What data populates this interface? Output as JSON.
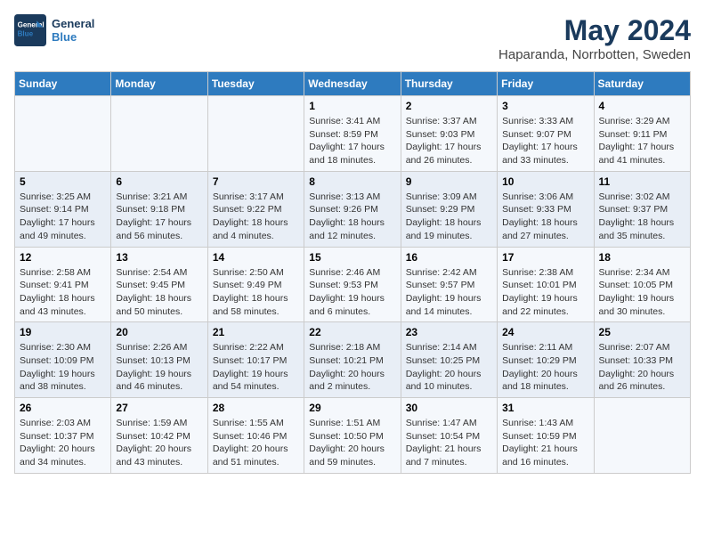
{
  "header": {
    "logo_line1": "General",
    "logo_line2": "Blue",
    "main_title": "May 2024",
    "subtitle": "Haparanda, Norrbotten, Sweden"
  },
  "days_of_week": [
    "Sunday",
    "Monday",
    "Tuesday",
    "Wednesday",
    "Thursday",
    "Friday",
    "Saturday"
  ],
  "weeks": [
    [
      {
        "num": "",
        "detail": ""
      },
      {
        "num": "",
        "detail": ""
      },
      {
        "num": "",
        "detail": ""
      },
      {
        "num": "1",
        "detail": "Sunrise: 3:41 AM\nSunset: 8:59 PM\nDaylight: 17 hours\nand 18 minutes."
      },
      {
        "num": "2",
        "detail": "Sunrise: 3:37 AM\nSunset: 9:03 PM\nDaylight: 17 hours\nand 26 minutes."
      },
      {
        "num": "3",
        "detail": "Sunrise: 3:33 AM\nSunset: 9:07 PM\nDaylight: 17 hours\nand 33 minutes."
      },
      {
        "num": "4",
        "detail": "Sunrise: 3:29 AM\nSunset: 9:11 PM\nDaylight: 17 hours\nand 41 minutes."
      }
    ],
    [
      {
        "num": "5",
        "detail": "Sunrise: 3:25 AM\nSunset: 9:14 PM\nDaylight: 17 hours\nand 49 minutes."
      },
      {
        "num": "6",
        "detail": "Sunrise: 3:21 AM\nSunset: 9:18 PM\nDaylight: 17 hours\nand 56 minutes."
      },
      {
        "num": "7",
        "detail": "Sunrise: 3:17 AM\nSunset: 9:22 PM\nDaylight: 18 hours\nand 4 minutes."
      },
      {
        "num": "8",
        "detail": "Sunrise: 3:13 AM\nSunset: 9:26 PM\nDaylight: 18 hours\nand 12 minutes."
      },
      {
        "num": "9",
        "detail": "Sunrise: 3:09 AM\nSunset: 9:29 PM\nDaylight: 18 hours\nand 19 minutes."
      },
      {
        "num": "10",
        "detail": "Sunrise: 3:06 AM\nSunset: 9:33 PM\nDaylight: 18 hours\nand 27 minutes."
      },
      {
        "num": "11",
        "detail": "Sunrise: 3:02 AM\nSunset: 9:37 PM\nDaylight: 18 hours\nand 35 minutes."
      }
    ],
    [
      {
        "num": "12",
        "detail": "Sunrise: 2:58 AM\nSunset: 9:41 PM\nDaylight: 18 hours\nand 43 minutes."
      },
      {
        "num": "13",
        "detail": "Sunrise: 2:54 AM\nSunset: 9:45 PM\nDaylight: 18 hours\nand 50 minutes."
      },
      {
        "num": "14",
        "detail": "Sunrise: 2:50 AM\nSunset: 9:49 PM\nDaylight: 18 hours\nand 58 minutes."
      },
      {
        "num": "15",
        "detail": "Sunrise: 2:46 AM\nSunset: 9:53 PM\nDaylight: 19 hours\nand 6 minutes."
      },
      {
        "num": "16",
        "detail": "Sunrise: 2:42 AM\nSunset: 9:57 PM\nDaylight: 19 hours\nand 14 minutes."
      },
      {
        "num": "17",
        "detail": "Sunrise: 2:38 AM\nSunset: 10:01 PM\nDaylight: 19 hours\nand 22 minutes."
      },
      {
        "num": "18",
        "detail": "Sunrise: 2:34 AM\nSunset: 10:05 PM\nDaylight: 19 hours\nand 30 minutes."
      }
    ],
    [
      {
        "num": "19",
        "detail": "Sunrise: 2:30 AM\nSunset: 10:09 PM\nDaylight: 19 hours\nand 38 minutes."
      },
      {
        "num": "20",
        "detail": "Sunrise: 2:26 AM\nSunset: 10:13 PM\nDaylight: 19 hours\nand 46 minutes."
      },
      {
        "num": "21",
        "detail": "Sunrise: 2:22 AM\nSunset: 10:17 PM\nDaylight: 19 hours\nand 54 minutes."
      },
      {
        "num": "22",
        "detail": "Sunrise: 2:18 AM\nSunset: 10:21 PM\nDaylight: 20 hours\nand 2 minutes."
      },
      {
        "num": "23",
        "detail": "Sunrise: 2:14 AM\nSunset: 10:25 PM\nDaylight: 20 hours\nand 10 minutes."
      },
      {
        "num": "24",
        "detail": "Sunrise: 2:11 AM\nSunset: 10:29 PM\nDaylight: 20 hours\nand 18 minutes."
      },
      {
        "num": "25",
        "detail": "Sunrise: 2:07 AM\nSunset: 10:33 PM\nDaylight: 20 hours\nand 26 minutes."
      }
    ],
    [
      {
        "num": "26",
        "detail": "Sunrise: 2:03 AM\nSunset: 10:37 PM\nDaylight: 20 hours\nand 34 minutes."
      },
      {
        "num": "27",
        "detail": "Sunrise: 1:59 AM\nSunset: 10:42 PM\nDaylight: 20 hours\nand 43 minutes."
      },
      {
        "num": "28",
        "detail": "Sunrise: 1:55 AM\nSunset: 10:46 PM\nDaylight: 20 hours\nand 51 minutes."
      },
      {
        "num": "29",
        "detail": "Sunrise: 1:51 AM\nSunset: 10:50 PM\nDaylight: 20 hours\nand 59 minutes."
      },
      {
        "num": "30",
        "detail": "Sunrise: 1:47 AM\nSunset: 10:54 PM\nDaylight: 21 hours\nand 7 minutes."
      },
      {
        "num": "31",
        "detail": "Sunrise: 1:43 AM\nSunset: 10:59 PM\nDaylight: 21 hours\nand 16 minutes."
      },
      {
        "num": "",
        "detail": ""
      }
    ]
  ]
}
